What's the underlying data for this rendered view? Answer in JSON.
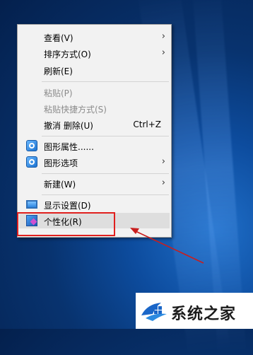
{
  "context_menu": {
    "items": [
      {
        "label": "查看(V)",
        "submenu": true
      },
      {
        "label": "排序方式(O)",
        "submenu": true
      },
      {
        "label": "刷新(E)"
      },
      {
        "label": "粘贴(P)",
        "disabled": true
      },
      {
        "label": "粘贴快捷方式(S)",
        "disabled": true
      },
      {
        "label": "撤消 删除(U)",
        "accelerator": "Ctrl+Z"
      },
      {
        "label": "图形属性......",
        "icon": "graphics-icon"
      },
      {
        "label": "图形选项",
        "icon": "graphics-icon",
        "submenu": true
      },
      {
        "label": "新建(W)",
        "submenu": true
      },
      {
        "label": "显示设置(D)",
        "icon": "display-icon"
      },
      {
        "label": "个性化(R)",
        "icon": "personalize-icon",
        "highlighted": true
      }
    ]
  },
  "annotation": {
    "color": "#e0201e"
  },
  "watermark": {
    "text": "系统之家"
  }
}
